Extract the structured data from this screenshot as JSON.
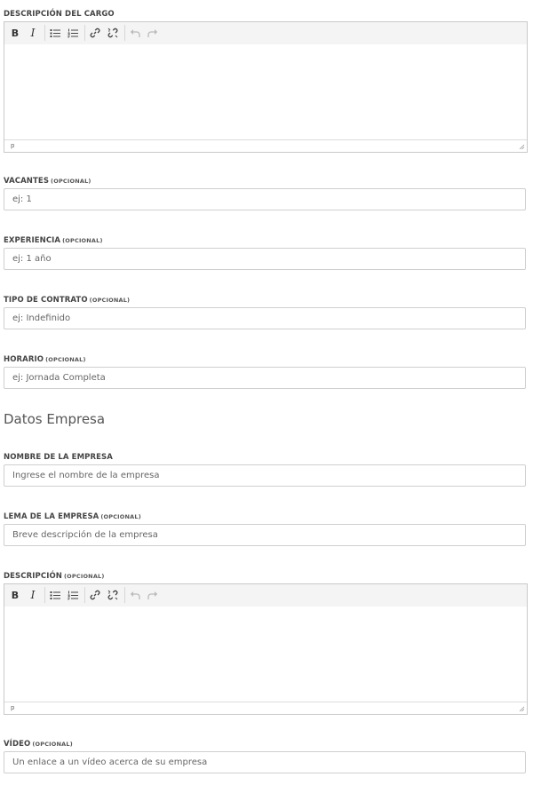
{
  "job": {
    "description_label": "DESCRIPCIÓN DEL CARGO",
    "description_path": "p",
    "vacancies_label": "VACANTES",
    "vacancies_optional": "(OPCIONAL)",
    "vacancies_placeholder": "ej: 1",
    "experience_label": "EXPERIENCIA",
    "experience_optional": "(OPCIONAL)",
    "experience_placeholder": "ej: 1 año",
    "contract_label": "TIPO DE CONTRATO",
    "contract_optional": "(OPCIONAL)",
    "contract_placeholder": "ej: Indefinido",
    "schedule_label": "HORARIO",
    "schedule_optional": "(OPCIONAL)",
    "schedule_placeholder": "ej: Jornada Completa"
  },
  "company": {
    "section_title": "Datos Empresa",
    "name_label": "NOMBRE DE LA EMPRESA",
    "name_placeholder": "Ingrese el nombre de la empresa",
    "tagline_label": "LEMA DE LA EMPRESA",
    "tagline_optional": "(OPCIONAL)",
    "tagline_placeholder": "Breve descripción de la empresa",
    "description_label": "DESCRIPCIÓN",
    "description_optional": "(OPCIONAL)",
    "description_path": "p",
    "video_label": "VÍDEO",
    "video_optional": "(OPCIONAL)",
    "video_placeholder": "Un enlace a un vídeo acerca de su empresa"
  },
  "toolbar": {
    "bold": "B",
    "italic": "I"
  },
  "colors": {
    "border": "#cfcfcf",
    "toolbar_bg": "#f4f4f4",
    "label_text": "#444444",
    "input_text": "#555555",
    "disabled_icon": "#bbbbbb"
  }
}
